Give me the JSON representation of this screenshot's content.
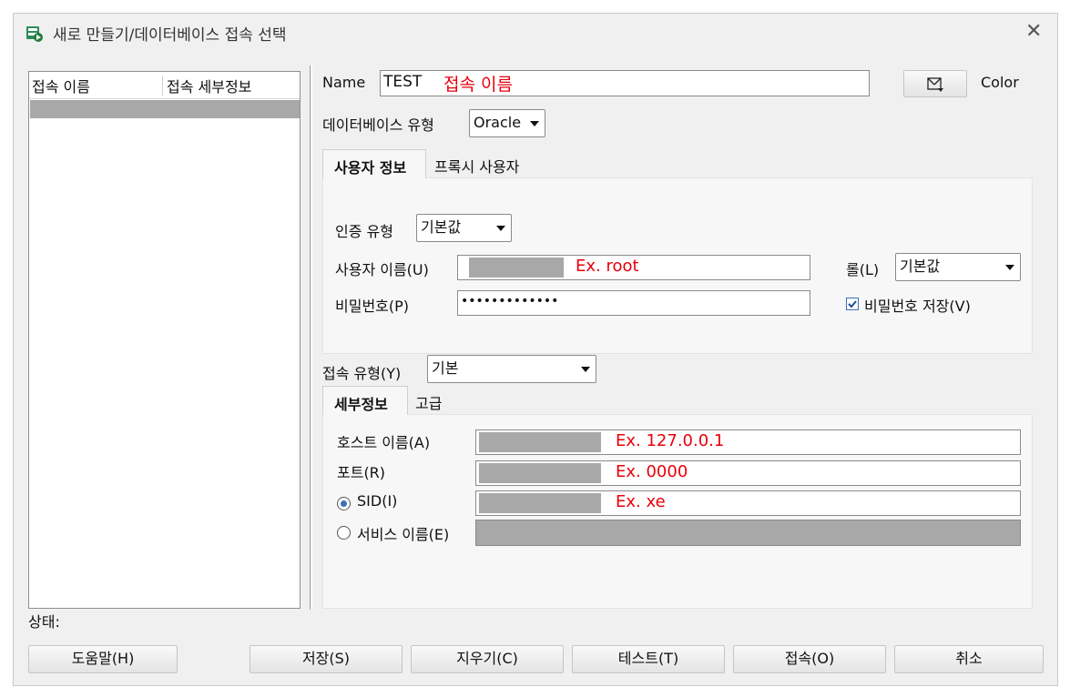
{
  "window": {
    "title": "새로 만들기/데이터베이스 접속 선택",
    "close_glyph": "✕"
  },
  "conn_list": {
    "col_name": "접속 이름",
    "col_details": "접속 세부정보"
  },
  "form": {
    "name_label": "Name",
    "name_value": "TEST",
    "name_annotation": "접속 이름",
    "color_label": "Color",
    "color_icon_glyph": "🖂",
    "dbtype_label": "데이터베이스 유형",
    "dbtype_value": "Oracle"
  },
  "user_tabs": {
    "active": "사용자 정보",
    "other": "프록시 사용자"
  },
  "user_info": {
    "auth_label": "인증 유형",
    "auth_value": "기본값",
    "username_label": "사용자 이름(U)",
    "username_hint": "Ex. root",
    "role_label": "롤(L)",
    "role_value": "기본값",
    "password_label": "비밀번호(P)",
    "password_value": "•••••••••••••",
    "save_password_label": "비밀번호 저장(V)",
    "save_password_checked": true
  },
  "connection": {
    "type_label": "접속 유형(Y)",
    "type_value": "기본"
  },
  "detail_tabs": {
    "active": "세부정보",
    "other": "고급"
  },
  "details": {
    "host_label": "호스트 이름(A)",
    "host_hint": "Ex. 127.0.0.1",
    "port_label": "포트(R)",
    "port_hint": "Ex. 0000",
    "sid_label": "SID(I)",
    "sid_hint": "Ex. xe",
    "service_label": "서비스 이름(E)"
  },
  "status_label": "상태:",
  "buttons": {
    "help": "도움말(H)",
    "save": "저장(S)",
    "clear": "지우기(C)",
    "test": "테스트(T)",
    "connect": "접속(O)",
    "cancel": "취소"
  },
  "colors": {
    "annotation_red": "#e8000a",
    "selection_gray": "#a8a8a8",
    "accent_blue": "#3b6fb6"
  }
}
